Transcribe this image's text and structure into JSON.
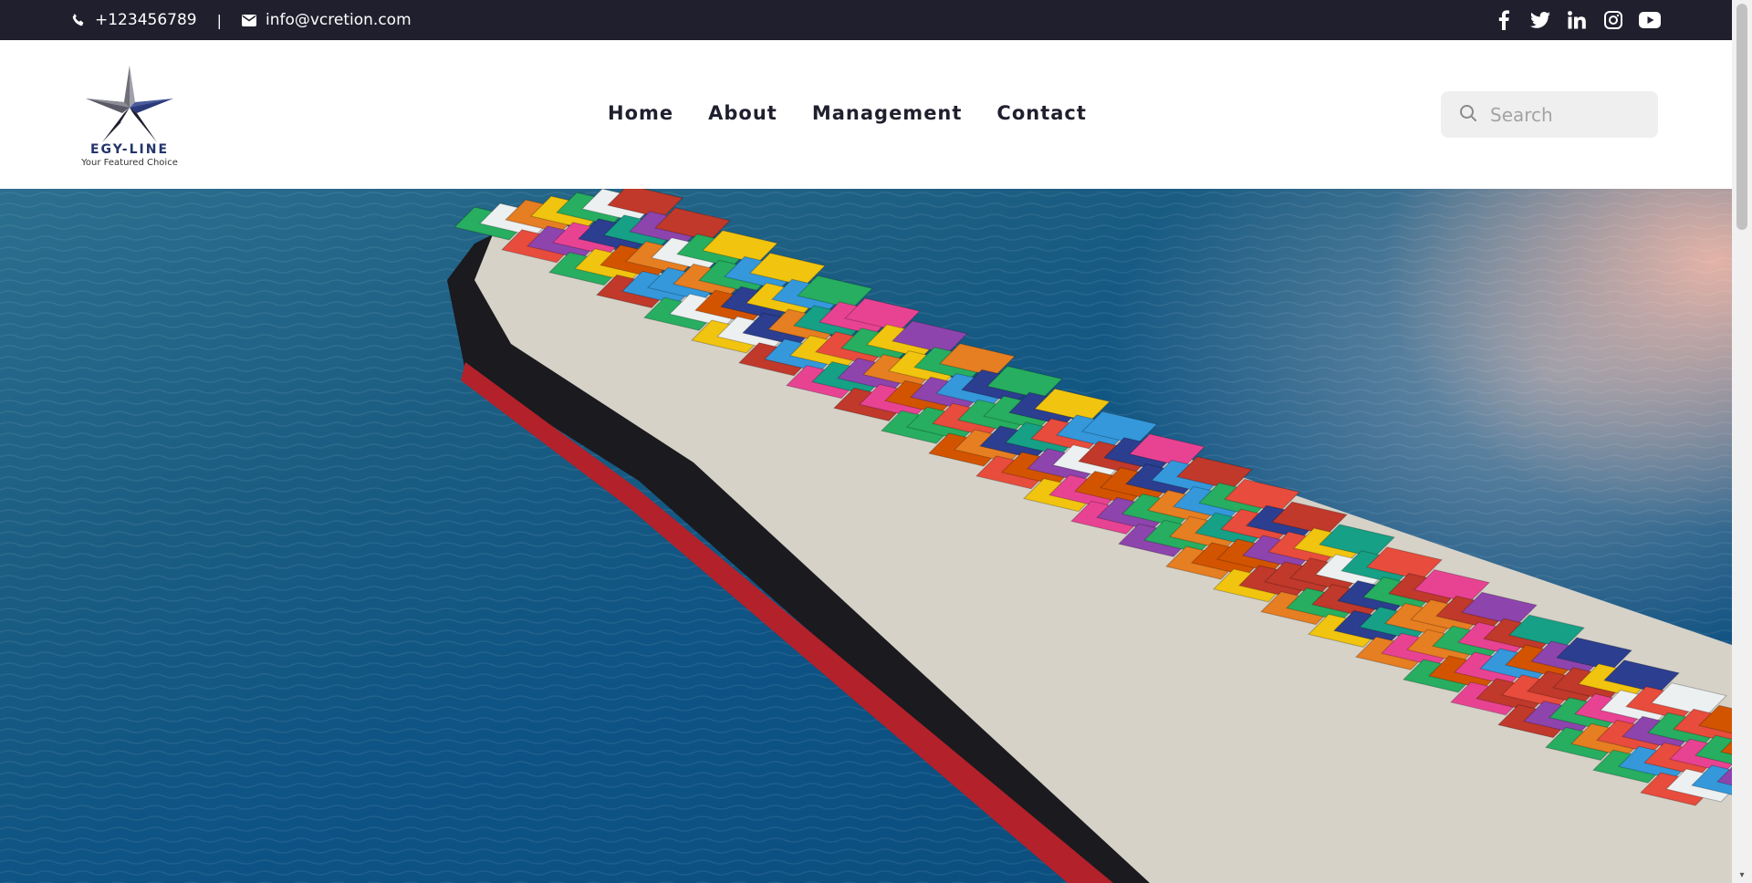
{
  "topbar": {
    "phone": "+123456789",
    "separator": "|",
    "email": "info@vcretion.com",
    "social": [
      {
        "icon": "facebook-icon"
      },
      {
        "icon": "twitter-icon"
      },
      {
        "icon": "linkedin-icon"
      },
      {
        "icon": "instagram-icon"
      },
      {
        "icon": "youtube-icon"
      }
    ]
  },
  "header": {
    "logo": {
      "name": "EGY-LINE",
      "tagline": "Your Featured Choice"
    },
    "nav": [
      "Home",
      "About",
      "Management",
      "Contact"
    ],
    "search": {
      "placeholder": "Search",
      "value": ""
    }
  },
  "colors": {
    "topbar_bg": "#1f1f2e",
    "nav_text": "#1f1f2e",
    "search_bg": "#efefef",
    "logo_blue": "#24346b"
  },
  "hero": {
    "image": "aerial view of a container ship loaded with colorful shipping containers on blue sea"
  }
}
